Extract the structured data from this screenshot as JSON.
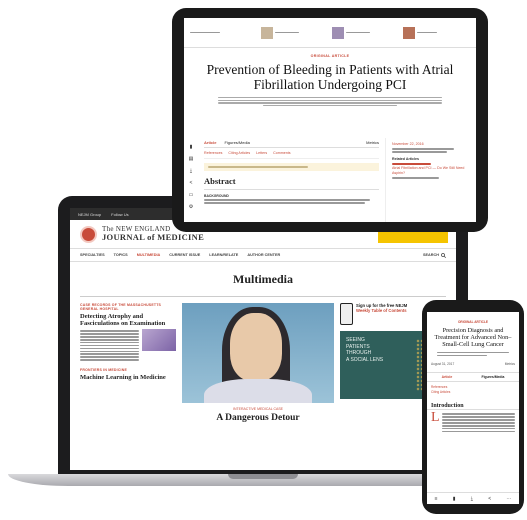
{
  "laptop": {
    "topbar": [
      "NEJM Group",
      "Follow Us"
    ],
    "logo": {
      "line1": "The NEW ENGLAND",
      "line2": "JOURNAL of MEDICINE"
    },
    "nav": [
      "SPECIALTIES",
      "TOPICS",
      "MULTIMEDIA",
      "CURRENT ISSUE",
      "LEARN/RELATE",
      "AUTHOR CENTER"
    ],
    "nav_active": "MULTIMEDIA",
    "search_label": "SEARCH",
    "page_title": "Multimedia",
    "left_article": {
      "kicker": "CASE RECORDS OF THE MASSACHUSETTS GENERAL HOSPITAL",
      "title": "Detecting Atrophy and Fasciculations on Examination"
    },
    "left_article2": {
      "kicker": "FRONTIERS IN MEDICINE",
      "title": "Machine Learning in Medicine"
    },
    "center_feature": {
      "kicker": "INTERACTIVE MEDICAL CASE",
      "title": "A Dangerous Detour"
    },
    "promo": {
      "text": "Sign up for the free NEJM",
      "highlight": "Weekly Table of Contents"
    },
    "green_ad": {
      "line1": "SEEING",
      "line2": "PATIENTS",
      "line3": "THROUGH",
      "line4": "A SOCIAL LENS"
    }
  },
  "tablet": {
    "kicker": "ORIGINAL ARTICLE",
    "title": "Prevention of Bleeding in Patients with Atrial Fibrillation Undergoing PCI",
    "tabs": [
      "Article",
      "Figures/Media",
      "Metrics"
    ],
    "links": [
      "References",
      "Citing Articles",
      "Letters",
      "Comments"
    ],
    "abstract": "Abstract",
    "background": "BACKGROUND",
    "side": {
      "date": "November 22, 2016",
      "related_heading": "Related Articles",
      "related_title": "Atrial Fibrillation and PCI — Do We Still Need Aspirin?"
    }
  },
  "phone": {
    "kicker": "ORIGINAL ARTICLE",
    "title": "Precision Diagnosis and Treatment for Advanced Non–Small-Cell Lung Cancer",
    "meta": [
      "August 31, 2017",
      "Metrics"
    ],
    "tabs": [
      "Article",
      "Figures/Media"
    ],
    "links": [
      "References",
      "Citing Articles"
    ],
    "intro": "Introduction",
    "drop": "L"
  }
}
